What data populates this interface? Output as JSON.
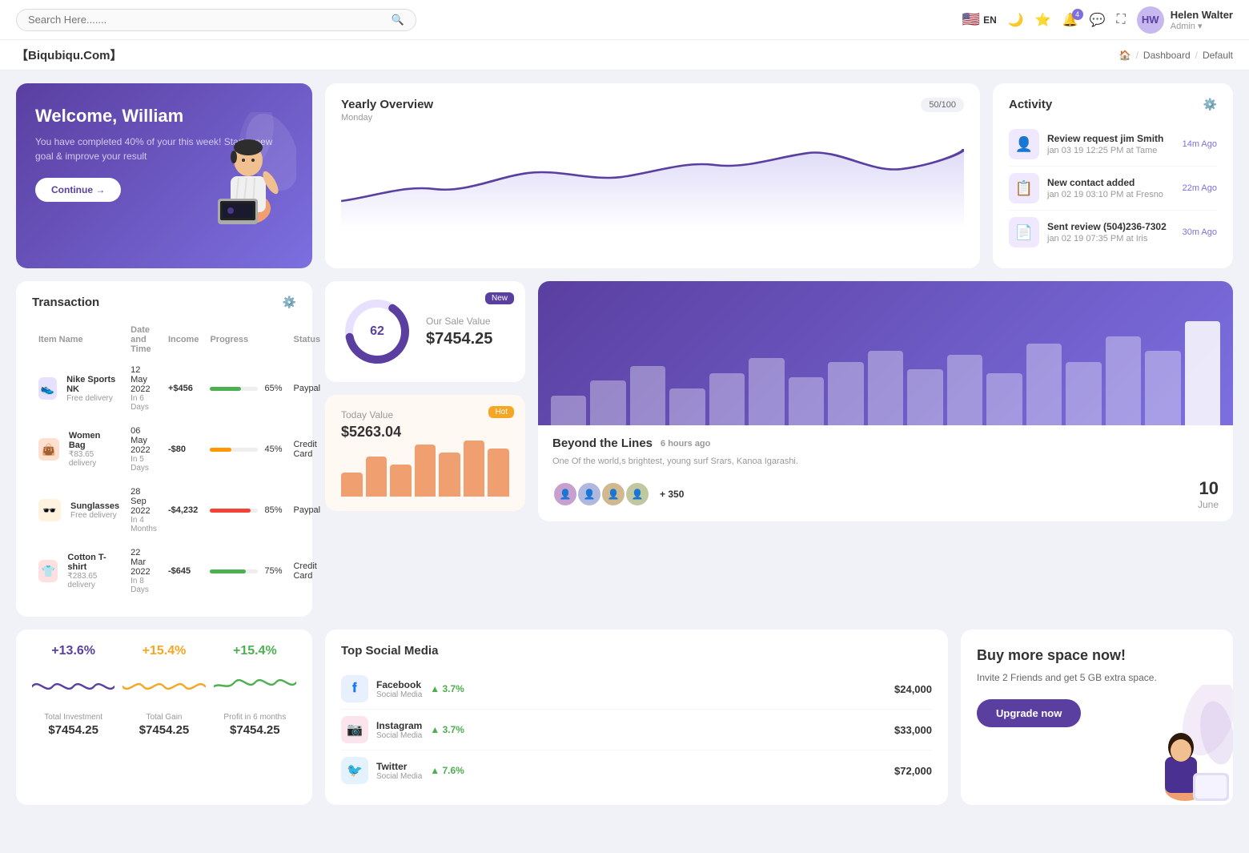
{
  "topnav": {
    "search_placeholder": "Search Here.......",
    "lang": "EN",
    "notifications_count": "4",
    "user": {
      "name": "Helen Walter",
      "role": "Admin",
      "initials": "HW"
    }
  },
  "breadcrumb": {
    "brand": "【Biqubiqu.Com】",
    "items": [
      "Dashboard",
      "Default"
    ]
  },
  "welcome": {
    "title": "Welcome, William",
    "subtitle": "You have completed 40% of your this week! Start a new goal & improve your result",
    "button": "Continue →"
  },
  "yearly": {
    "title": "Yearly Overview",
    "subtitle": "Monday",
    "badge": "50/100"
  },
  "activity": {
    "title": "Activity",
    "items": [
      {
        "title": "Review request jim Smith",
        "sub": "jan 03 19 12:25 PM at Tame",
        "time": "14m Ago",
        "icon": "👤"
      },
      {
        "title": "New contact added",
        "sub": "jan 02 19 03:10 PM at Fresno",
        "time": "22m Ago",
        "icon": "📋"
      },
      {
        "title": "Sent review (504)236-7302",
        "sub": "jan 02 19 07:35 PM at Iris",
        "time": "30m Ago",
        "icon": "📄"
      }
    ]
  },
  "transaction": {
    "title": "Transaction",
    "columns": [
      "Item Name",
      "Date and Time",
      "Income",
      "Progress",
      "Status"
    ],
    "rows": [
      {
        "name": "Nike Sports NK",
        "sub": "Free delivery",
        "date": "12 May 2022",
        "days": "In 6 Days",
        "income": "+$456",
        "progress": 65,
        "status": "Paypal",
        "icon": "👟",
        "color": "#e8e0ff"
      },
      {
        "name": "Women Bag",
        "sub": "₹83.65 delivery",
        "date": "06 May 2022",
        "days": "In 5 Days",
        "income": "-$80",
        "progress": 45,
        "status": "Credit Card",
        "icon": "👜",
        "color": "#ffe0d0"
      },
      {
        "name": "Sunglasses",
        "sub": "Free delivery",
        "date": "28 Sep 2022",
        "days": "In 4 Months",
        "income": "-$4,232",
        "progress": 85,
        "status": "Paypal",
        "icon": "🕶️",
        "color": "#fff3e0"
      },
      {
        "name": "Cotton T-shirt",
        "sub": "₹283.65 delivery",
        "date": "22 Mar 2022",
        "days": "In 8 Days",
        "income": "-$645",
        "progress": 75,
        "status": "Credit Card",
        "icon": "👕",
        "color": "#ffe0e0"
      }
    ]
  },
  "sale_value": {
    "title": "Our Sale Value",
    "amount": "$7454.25",
    "percent": 62,
    "badge": "New"
  },
  "today_value": {
    "title": "Today Value",
    "amount": "$5263.04",
    "badge": "Hot",
    "bars": [
      30,
      50,
      40,
      65,
      55,
      70,
      60
    ]
  },
  "beyond": {
    "title": "Beyond the Lines",
    "time_ago": "6 hours ago",
    "desc": "One Of the world,s brightest, young surf Srars, Kanoa Igarashi.",
    "plus_count": "+ 350",
    "date_day": "10",
    "date_month": "June",
    "bars": [
      40,
      60,
      80,
      50,
      70,
      90,
      65,
      85,
      100,
      75,
      95,
      70,
      110,
      85,
      120,
      100,
      140
    ]
  },
  "stats": [
    {
      "pct": "+13.6%",
      "color": "purple",
      "label": "Total Investment",
      "value": "$7454.25"
    },
    {
      "pct": "+15.4%",
      "color": "orange",
      "label": "Total Gain",
      "value": "$7454.25"
    },
    {
      "pct": "+15.4%",
      "color": "green",
      "label": "Profit in 6 months",
      "value": "$7454.25"
    }
  ],
  "social": {
    "title": "Top Social Media",
    "items": [
      {
        "name": "Facebook",
        "sub": "Social Media",
        "pct": "3.7%",
        "amount": "$24,000",
        "color": "#e8f0fe",
        "icon": "f",
        "icon_color": "#1877f2"
      },
      {
        "name": "Instagram",
        "sub": "Social Media",
        "pct": "3.7%",
        "amount": "$33,000",
        "color": "#fce4ec",
        "icon": "📷",
        "icon_color": "#e1306c"
      },
      {
        "name": "Twitter",
        "sub": "Social Media",
        "pct": "7.6%",
        "amount": "$72,000",
        "color": "#e3f2fd",
        "icon": "🐦",
        "icon_color": "#1da1f2"
      }
    ]
  },
  "upgrade": {
    "title": "Buy more space now!",
    "desc": "Invite 2 Friends and get 5 GB extra space.",
    "button": "Upgrade now"
  },
  "progress_colors": {
    "65": "#4caf50",
    "45": "#ff9800",
    "85": "#f44336",
    "75": "#4caf50"
  }
}
